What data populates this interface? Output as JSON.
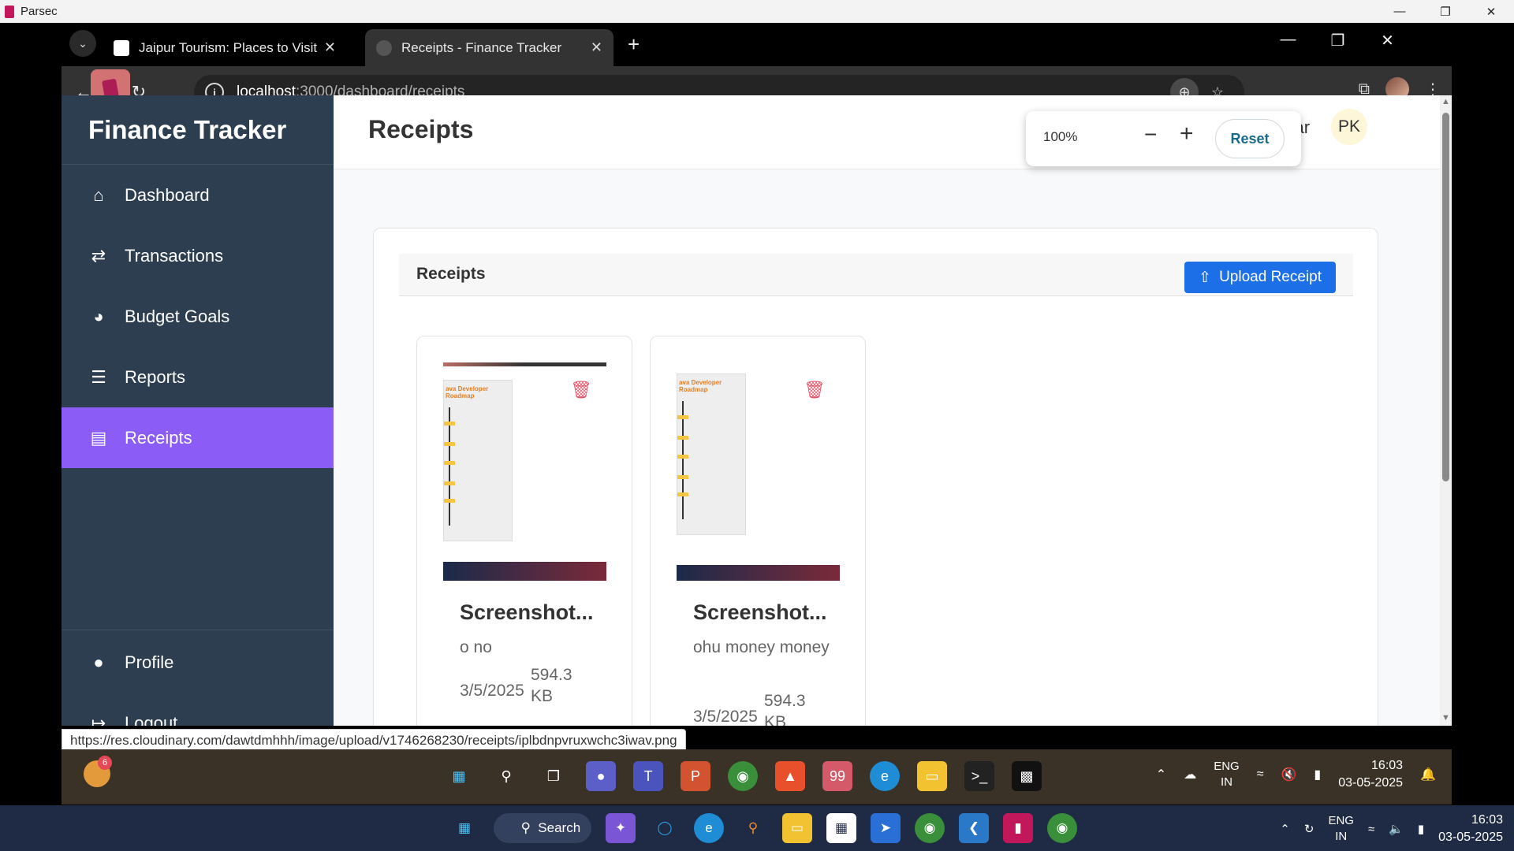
{
  "parsec": {
    "title": "Parsec"
  },
  "browser": {
    "tabs": [
      {
        "title": "Jaipur Tourism: Places to Visit, S"
      },
      {
        "title": "Receipts - Finance Tracker"
      }
    ],
    "url_host": "localhost",
    "url_path": ":3000/dashboard/receipts",
    "status_url": "https://res.cloudinary.com/dawtdmhhh/image/upload/v1746268230/receipts/iplbdnpvruxwchc3iwav.png",
    "zoom": {
      "value": "100%",
      "reset_label": "Reset"
    }
  },
  "app": {
    "brand": "Finance Tracker",
    "nav": [
      {
        "label": "Dashboard",
        "icon": "home-icon"
      },
      {
        "label": "Transactions",
        "icon": "exchange-icon"
      },
      {
        "label": "Budget Goals",
        "icon": "pie-chart-icon"
      },
      {
        "label": "Reports",
        "icon": "bar-chart-icon"
      },
      {
        "label": "Receipts",
        "icon": "receipt-icon",
        "active": true
      }
    ],
    "nav_bottom": [
      {
        "label": "Profile",
        "icon": "user-icon"
      },
      {
        "label": "Logout",
        "icon": "logout-icon"
      }
    ],
    "page_title": "Receipts",
    "user_name": "kumar",
    "user_initials": "PK",
    "card_title": "Receipts",
    "upload_label": "Upload Receipt",
    "receipts": [
      {
        "name": "Screenshot...",
        "description": "o no",
        "date": "3/5/2025",
        "size_value": "594.3",
        "size_unit": "KB",
        "thumb_title": "ava Developer\n Roadmap"
      },
      {
        "name": "Screenshot...",
        "description": "ohu money money",
        "date": "3/5/2025",
        "size_value": "594.3",
        "size_unit": "KB",
        "thumb_title": "ava Developer\n Roadmap"
      }
    ],
    "colors": {
      "sidebar": "#2c3e50",
      "active_nav": "#8b5cf6",
      "upload_button": "#1d6fe8",
      "delete": "#e0566a"
    }
  },
  "remote_taskbar": {
    "weather_badge": "6",
    "telegram_badge": "99",
    "lang_top": "ENG",
    "lang_bottom": "IN",
    "time": "16:03",
    "date": "03-05-2025"
  },
  "local_taskbar": {
    "search_label": "Search",
    "lang_top": "ENG",
    "lang_bottom": "IN",
    "time": "16:03",
    "date": "03-05-2025"
  }
}
